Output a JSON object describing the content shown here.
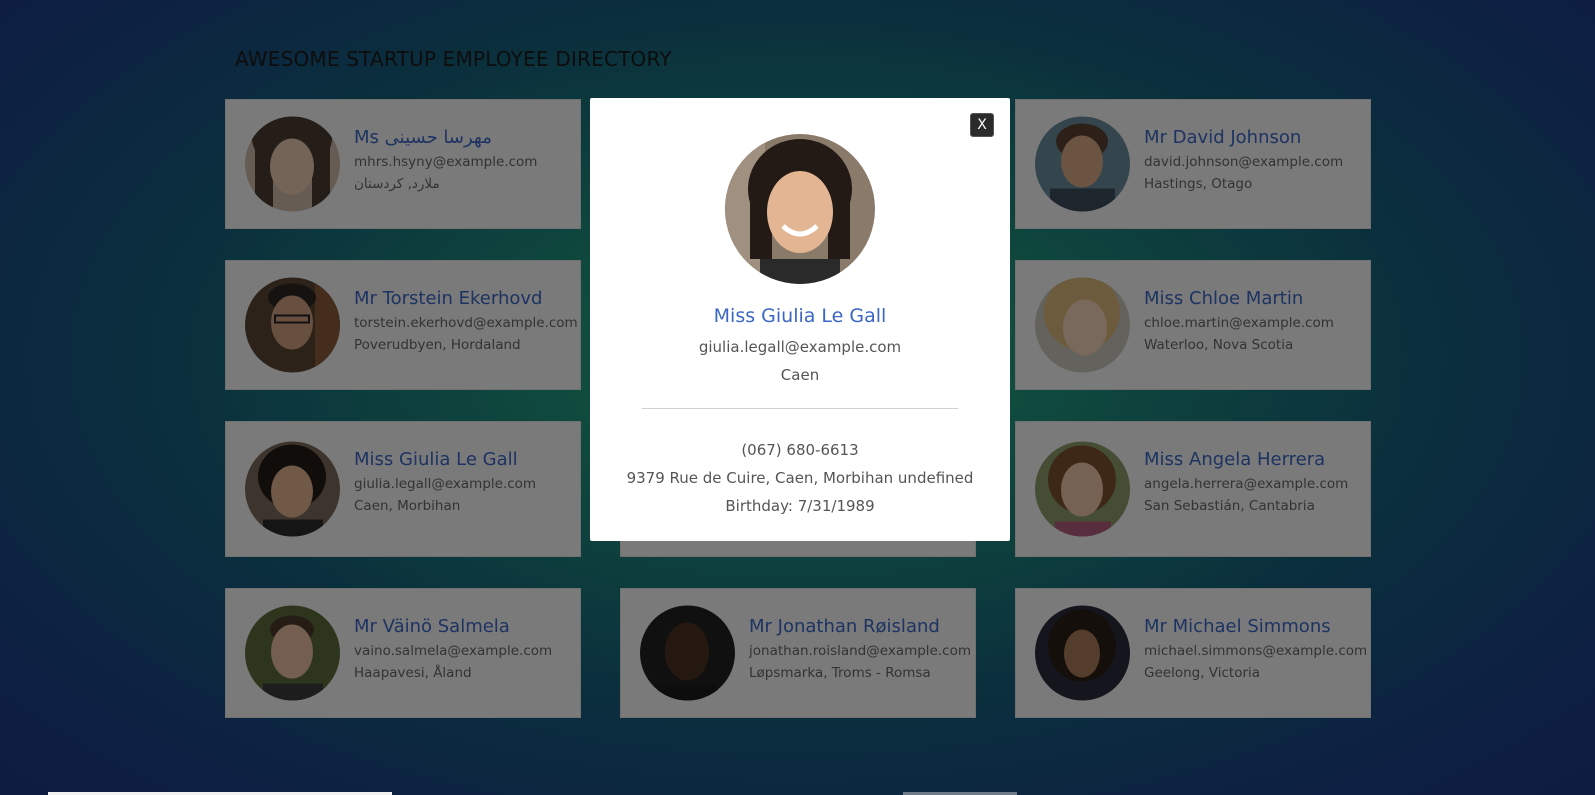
{
  "header": {
    "title": "AWESOME STARTUP EMPLOYEE DIRECTORY"
  },
  "cards": [
    {
      "name": "Ms مهرسا حسینی",
      "email": "mhrs.hsyny@example.com",
      "location": "ملارد, کردستان"
    },
    {
      "name": "Mr David Johnson",
      "email": "david.johnson@example.com",
      "location": "Hastings, Otago"
    },
    {
      "name": "Mr Torstein Ekerhovd",
      "email": "torstein.ekerhovd@example.com",
      "location": "Poverudbyen, Hordaland"
    },
    {
      "name": "Miss Chloe Martin",
      "email": "chloe.martin@example.com",
      "location": "Waterloo, Nova Scotia"
    },
    {
      "name": "Miss Giulia Le Gall",
      "email": "giulia.legall@example.com",
      "location": "Caen, Morbihan"
    },
    {
      "name": "Miss Angela Herrera",
      "email": "angela.herrera@example.com",
      "location": "San Sebastián, Cantabria"
    },
    {
      "name": "Mr Väinö Salmela",
      "email": "vaino.salmela@example.com",
      "location": "Haapavesi, Åland"
    },
    {
      "name": "Mr Jonathan Røisland",
      "email": "jonathan.roisland@example.com",
      "location": "Løpsmarka, Troms - Romsa"
    },
    {
      "name": "Mr Michael Simmons",
      "email": "michael.simmons@example.com",
      "location": "Geelong, Victoria"
    }
  ],
  "modal": {
    "close_label": "X",
    "name": "Miss Giulia Le Gall",
    "email": "giulia.legall@example.com",
    "city": "Caen",
    "phone": "(067) 680-6613",
    "address": "9379 Rue de Cuire, Caen, Morbihan undefined",
    "birthday": "Birthday: 7/31/1989"
  },
  "colors": {
    "name_blue": "#3b66c4",
    "card_bg": "#f4f4f4",
    "modal_bg": "#ffffff",
    "close_bg": "#2b2b2b"
  }
}
